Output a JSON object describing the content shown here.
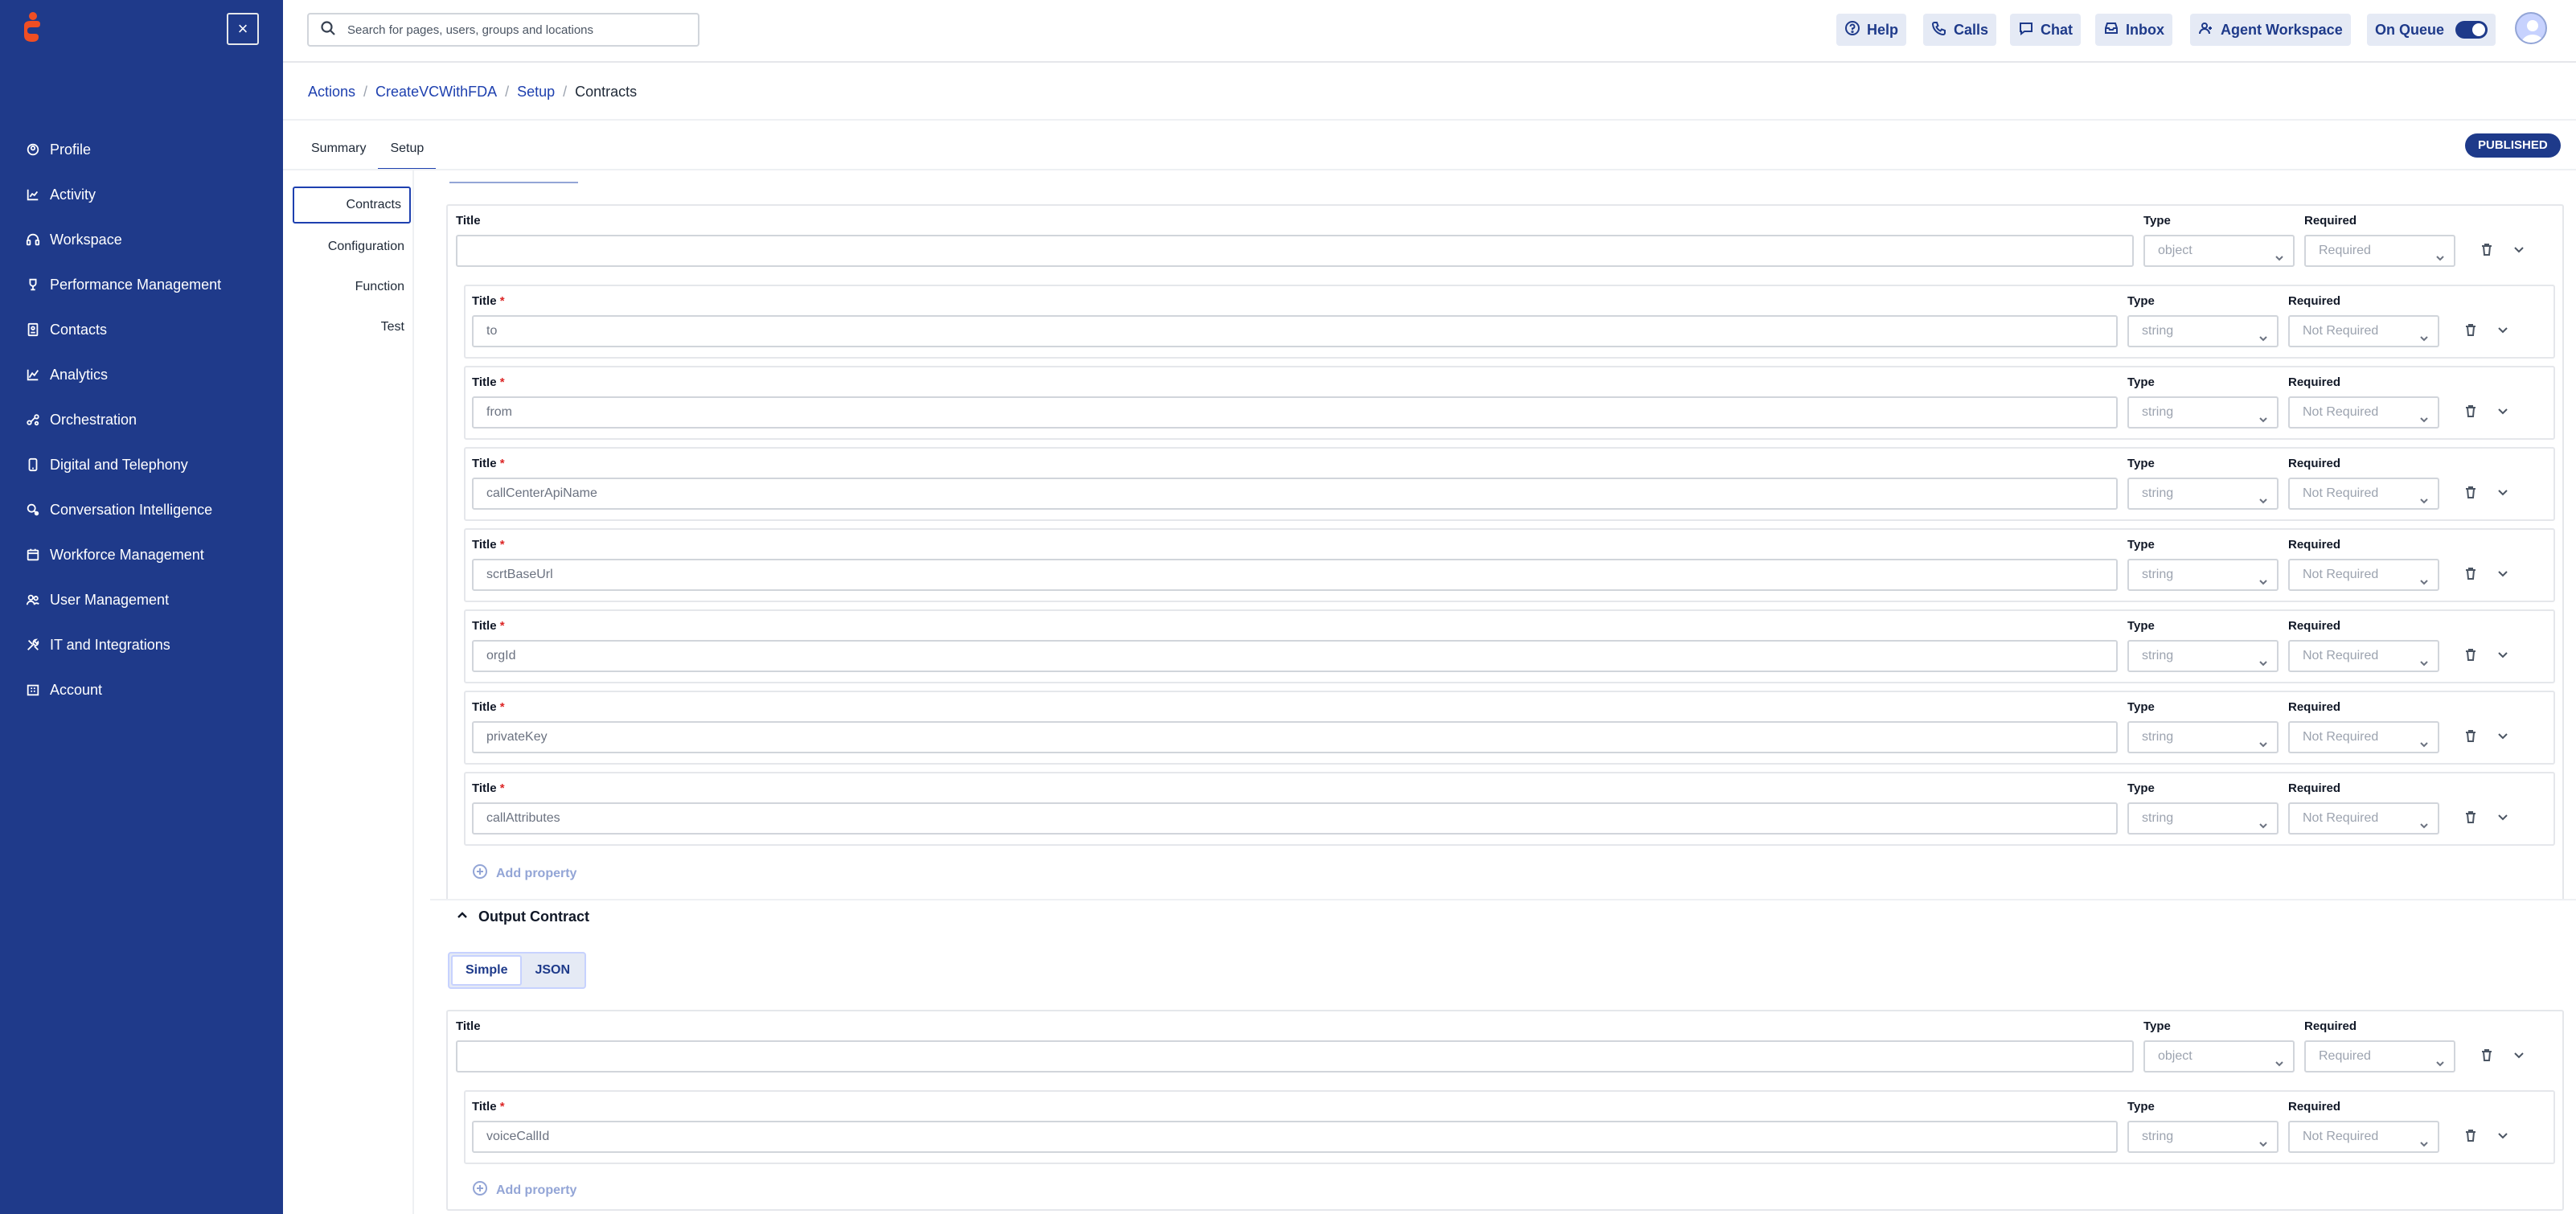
{
  "sidebar": {
    "items": [
      {
        "label": "Profile",
        "icon": "profile-icon"
      },
      {
        "label": "Activity",
        "icon": "activity-icon"
      },
      {
        "label": "Workspace",
        "icon": "headset-icon"
      },
      {
        "label": "Performance Management",
        "icon": "trophy-icon"
      },
      {
        "label": "Contacts",
        "icon": "contacts-icon"
      },
      {
        "label": "Analytics",
        "icon": "analytics-icon"
      },
      {
        "label": "Orchestration",
        "icon": "orchestration-icon"
      },
      {
        "label": "Digital and Telephony",
        "icon": "phone-icon"
      },
      {
        "label": "Conversation Intelligence",
        "icon": "conversation-icon"
      },
      {
        "label": "Workforce Management",
        "icon": "calendar-icon"
      },
      {
        "label": "User Management",
        "icon": "users-icon"
      },
      {
        "label": "IT and Integrations",
        "icon": "tools-icon"
      },
      {
        "label": "Account",
        "icon": "building-icon"
      }
    ],
    "collapse_label": "×"
  },
  "topbar": {
    "search_placeholder": "Search for pages, users, groups and locations",
    "help": "Help",
    "calls": "Calls",
    "chat": "Chat",
    "inbox": "Inbox",
    "agent_workspace": "Agent Workspace",
    "on_queue": "On Queue"
  },
  "breadcrumb": {
    "items": [
      "Actions",
      "CreateVCWithFDA",
      "Setup"
    ],
    "current": "Contracts"
  },
  "tabs": [
    "Summary",
    "Setup"
  ],
  "status_badge": "PUBLISHED",
  "subnav": [
    "Contracts",
    "Configuration",
    "Function",
    "Test"
  ],
  "labels": {
    "title": "Title",
    "type": "Type",
    "required": "Required",
    "required_mark": "*",
    "add_property": "Add property"
  },
  "input_contract": {
    "root": {
      "title": "",
      "type": "object",
      "required": "Required"
    },
    "properties": [
      {
        "title": "to",
        "type": "string",
        "required": "Not Required"
      },
      {
        "title": "from",
        "type": "string",
        "required": "Not Required"
      },
      {
        "title": "callCenterApiName",
        "type": "string",
        "required": "Not Required"
      },
      {
        "title": "scrtBaseUrl",
        "type": "string",
        "required": "Not Required"
      },
      {
        "title": "orgId",
        "type": "string",
        "required": "Not Required"
      },
      {
        "title": "privateKey",
        "type": "string",
        "required": "Not Required"
      },
      {
        "title": "callAttributes",
        "type": "string",
        "required": "Not Required"
      }
    ]
  },
  "output_contract": {
    "heading": "Output Contract",
    "modes": [
      "Simple",
      "JSON"
    ],
    "root": {
      "title": "",
      "type": "object",
      "required": "Required"
    },
    "properties": [
      {
        "title": "voiceCallId",
        "type": "string",
        "required": "Not Required"
      }
    ]
  },
  "colors": {
    "sidebar_bg": "#1f3a8a",
    "accent": "#1e40af",
    "required_star": "#dc2626"
  }
}
